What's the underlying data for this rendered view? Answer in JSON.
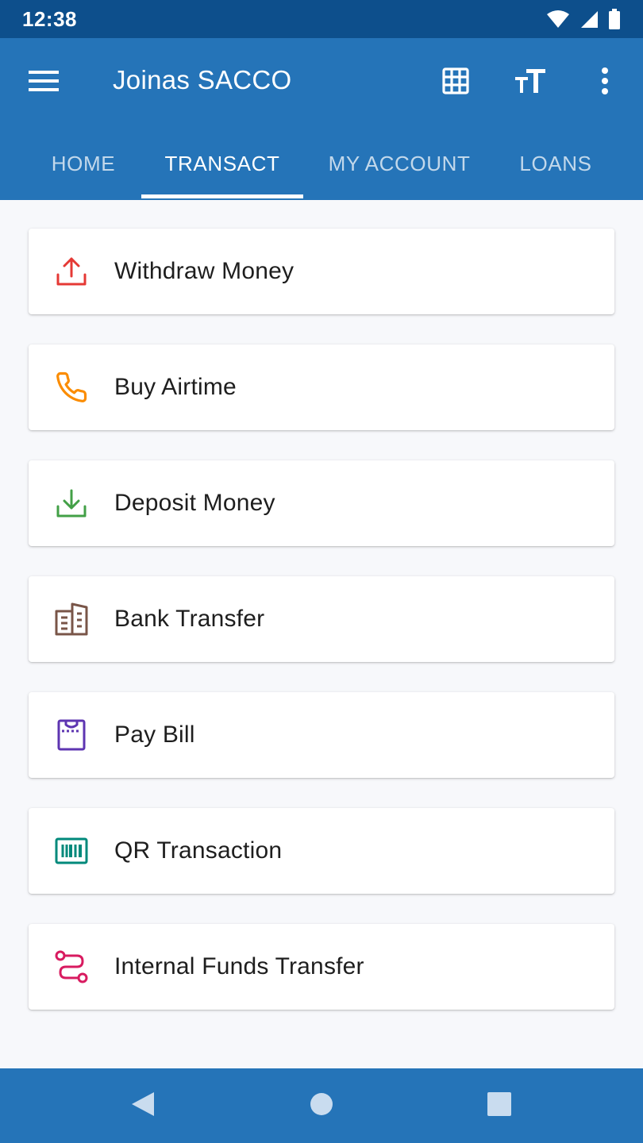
{
  "status_bar": {
    "time": "12:38",
    "icons": [
      "wifi-icon",
      "signal-icon",
      "battery-icon"
    ]
  },
  "app_bar": {
    "title": "Joinas SACCO",
    "actions": [
      "grid-icon",
      "text-size-icon",
      "more-vert-icon"
    ]
  },
  "tabs": [
    {
      "label": "HOME",
      "active": false
    },
    {
      "label": "TRANSACT",
      "active": true
    },
    {
      "label": "MY ACCOUNT",
      "active": false
    },
    {
      "label": "LOANS",
      "active": false
    }
  ],
  "transactions": [
    {
      "label": "Withdraw Money",
      "icon": "upload-icon",
      "color": "#e53935"
    },
    {
      "label": "Buy Airtime",
      "icon": "phone-icon",
      "color": "#fb8c00"
    },
    {
      "label": "Deposit Money",
      "icon": "download-icon",
      "color": "#43a047"
    },
    {
      "label": "Bank Transfer",
      "icon": "bank-icon",
      "color": "#795548"
    },
    {
      "label": "Pay Bill",
      "icon": "bill-icon",
      "color": "#5e35b1"
    },
    {
      "label": "QR Transaction",
      "icon": "barcode-icon",
      "color": "#00897b"
    },
    {
      "label": "Internal Funds Transfer",
      "icon": "route-icon",
      "color": "#d81b60"
    }
  ],
  "colors": {
    "primary": "#2574b8",
    "status_bar": "#0d4f8c",
    "background": "#f7f8fb"
  },
  "nav_bar": [
    "back-icon",
    "home-icon",
    "recent-apps-icon"
  ]
}
